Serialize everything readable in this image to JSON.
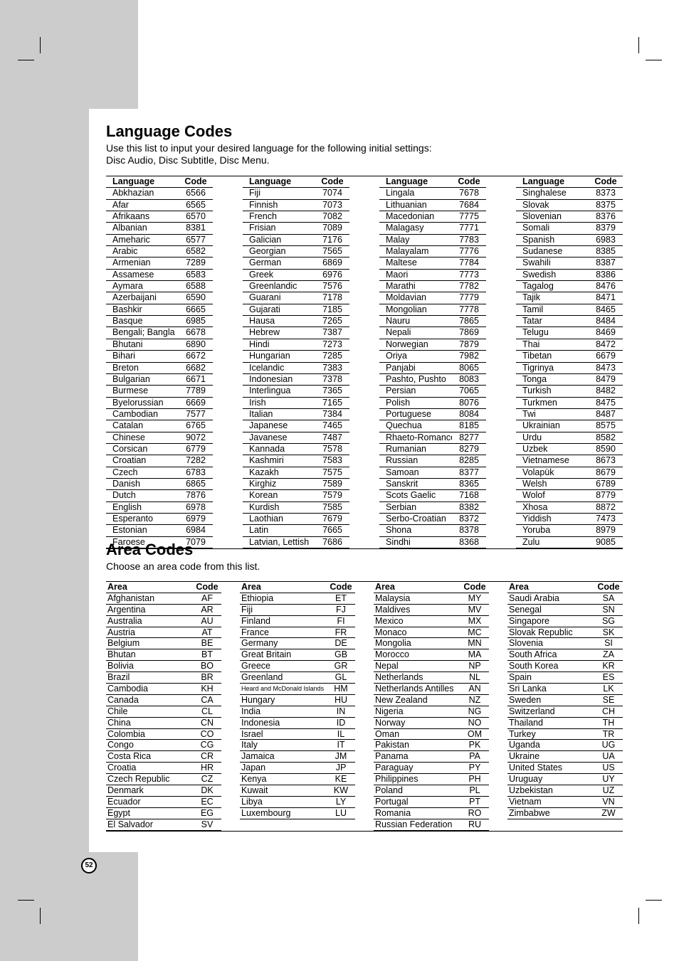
{
  "page_number": "52",
  "language_section": {
    "title": "Language Codes",
    "intro_line1": "Use this list to input your desired language for the following initial settings:",
    "intro_line2": "Disc Audio, Disc Subtitle, Disc Menu.",
    "header_name": "Language",
    "header_code": "Code",
    "columns": [
      [
        [
          "Abkhazian",
          "6566"
        ],
        [
          "Afar",
          "6565"
        ],
        [
          "Afrikaans",
          "6570"
        ],
        [
          "Albanian",
          "8381"
        ],
        [
          "Ameharic",
          "6577"
        ],
        [
          "Arabic",
          "6582"
        ],
        [
          "Armenian",
          "7289"
        ],
        [
          "Assamese",
          "6583"
        ],
        [
          "Aymara",
          "6588"
        ],
        [
          "Azerbaijani",
          "6590"
        ],
        [
          "Bashkir",
          "6665"
        ],
        [
          "Basque",
          "6985"
        ],
        [
          "Bengali; Bangla",
          "6678"
        ],
        [
          "Bhutani",
          "6890"
        ],
        [
          "Bihari",
          "6672"
        ],
        [
          "Breton",
          "6682"
        ],
        [
          "Bulgarian",
          "6671"
        ],
        [
          "Burmese",
          "7789"
        ],
        [
          "Byelorussian",
          "6669"
        ],
        [
          "Cambodian",
          "7577"
        ],
        [
          "Catalan",
          "6765"
        ],
        [
          "Chinese",
          "9072"
        ],
        [
          "Corsican",
          "6779"
        ],
        [
          "Croatian",
          "7282"
        ],
        [
          "Czech",
          "6783"
        ],
        [
          "Danish",
          "6865"
        ],
        [
          "Dutch",
          "7876"
        ],
        [
          "English",
          "6978"
        ],
        [
          "Esperanto",
          "6979"
        ],
        [
          "Estonian",
          "6984"
        ],
        [
          "Faroese",
          "7079"
        ]
      ],
      [
        [
          "Fiji",
          "7074"
        ],
        [
          "Finnish",
          "7073"
        ],
        [
          "French",
          "7082"
        ],
        [
          "Frisian",
          "7089"
        ],
        [
          "Galician",
          "7176"
        ],
        [
          "Georgian",
          "7565"
        ],
        [
          "German",
          "6869"
        ],
        [
          "Greek",
          "6976"
        ],
        [
          "Greenlandic",
          "7576"
        ],
        [
          "Guarani",
          "7178"
        ],
        [
          "Gujarati",
          "7185"
        ],
        [
          "Hausa",
          "7265"
        ],
        [
          "Hebrew",
          "7387"
        ],
        [
          "Hindi",
          "7273"
        ],
        [
          "Hungarian",
          "7285"
        ],
        [
          "Icelandic",
          "7383"
        ],
        [
          "Indonesian",
          "7378"
        ],
        [
          "Interlingua",
          "7365"
        ],
        [
          "Irish",
          "7165"
        ],
        [
          "Italian",
          "7384"
        ],
        [
          "Japanese",
          "7465"
        ],
        [
          "Javanese",
          "7487"
        ],
        [
          "Kannada",
          "7578"
        ],
        [
          "Kashmiri",
          "7583"
        ],
        [
          "Kazakh",
          "7575"
        ],
        [
          "Kirghiz",
          "7589"
        ],
        [
          "Korean",
          "7579"
        ],
        [
          "Kurdish",
          "7585"
        ],
        [
          "Laothian",
          "7679"
        ],
        [
          "Latin",
          "7665"
        ],
        [
          "Latvian, Lettish",
          "7686"
        ]
      ],
      [
        [
          "Lingala",
          "7678"
        ],
        [
          "Lithuanian",
          "7684"
        ],
        [
          "Macedonian",
          "7775"
        ],
        [
          "Malagasy",
          "7771"
        ],
        [
          "Malay",
          "7783"
        ],
        [
          "Malayalam",
          "7776"
        ],
        [
          "Maltese",
          "7784"
        ],
        [
          "Maori",
          "7773"
        ],
        [
          "Marathi",
          "7782"
        ],
        [
          "Moldavian",
          "7779"
        ],
        [
          "Mongolian",
          "7778"
        ],
        [
          "Nauru",
          "7865"
        ],
        [
          "Nepali",
          "7869"
        ],
        [
          "Norwegian",
          "7879"
        ],
        [
          "Oriya",
          "7982"
        ],
        [
          "Panjabi",
          "8065"
        ],
        [
          "Pashto, Pushto",
          "8083"
        ],
        [
          "Persian",
          "7065"
        ],
        [
          "Polish",
          "8076"
        ],
        [
          "Portuguese",
          "8084"
        ],
        [
          "Quechua",
          "8185"
        ],
        [
          "Rhaeto-Romance",
          "8277"
        ],
        [
          "Rumanian",
          "8279"
        ],
        [
          "Russian",
          "8285"
        ],
        [
          "Samoan",
          "8377"
        ],
        [
          "Sanskrit",
          "8365"
        ],
        [
          "Scots Gaelic",
          "7168"
        ],
        [
          "Serbian",
          "8382"
        ],
        [
          "Serbo-Croatian",
          "8372"
        ],
        [
          "Shona",
          "8378"
        ],
        [
          "Sindhi",
          "8368"
        ]
      ],
      [
        [
          "Singhalese",
          "8373"
        ],
        [
          "Slovak",
          "8375"
        ],
        [
          "Slovenian",
          "8376"
        ],
        [
          "Somali",
          "8379"
        ],
        [
          "Spanish",
          "6983"
        ],
        [
          "Sudanese",
          "8385"
        ],
        [
          "Swahili",
          "8387"
        ],
        [
          "Swedish",
          "8386"
        ],
        [
          "Tagalog",
          "8476"
        ],
        [
          "Tajik",
          "8471"
        ],
        [
          "Tamil",
          "8465"
        ],
        [
          "Tatar",
          "8484"
        ],
        [
          "Telugu",
          "8469"
        ],
        [
          "Thai",
          "8472"
        ],
        [
          "Tibetan",
          "6679"
        ],
        [
          "Tigrinya",
          "8473"
        ],
        [
          "Tonga",
          "8479"
        ],
        [
          "Turkish",
          "8482"
        ],
        [
          "Turkmen",
          "8475"
        ],
        [
          "Twi",
          "8487"
        ],
        [
          "Ukrainian",
          "8575"
        ],
        [
          "Urdu",
          "8582"
        ],
        [
          "Uzbek",
          "8590"
        ],
        [
          "Vietnamese",
          "8673"
        ],
        [
          "Volapük",
          "8679"
        ],
        [
          "Welsh",
          "6789"
        ],
        [
          "Wolof",
          "8779"
        ],
        [
          "Xhosa",
          "8872"
        ],
        [
          "Yiddish",
          "7473"
        ],
        [
          "Yoruba",
          "8979"
        ],
        [
          "Zulu",
          "9085"
        ]
      ]
    ]
  },
  "area_section": {
    "title": "Area Codes",
    "intro": "Choose an area code from this list.",
    "header_name": "Area",
    "header_code": "Code",
    "columns": [
      [
        [
          "Afghanistan",
          "AF"
        ],
        [
          "Argentina",
          "AR"
        ],
        [
          "Australia",
          "AU"
        ],
        [
          "Austria",
          "AT"
        ],
        [
          "Belgium",
          "BE"
        ],
        [
          "Bhutan",
          "BT"
        ],
        [
          "Bolivia",
          "BO"
        ],
        [
          "Brazil",
          "BR"
        ],
        [
          "Cambodia",
          "KH"
        ],
        [
          "Canada",
          "CA"
        ],
        [
          "Chile",
          "CL"
        ],
        [
          "China",
          "CN"
        ],
        [
          "Colombia",
          "CO"
        ],
        [
          "Congo",
          "CG"
        ],
        [
          "Costa Rica",
          "CR"
        ],
        [
          "Croatia",
          "HR"
        ],
        [
          "Czech Republic",
          "CZ"
        ],
        [
          "Denmark",
          "DK"
        ],
        [
          "Ecuador",
          "EC"
        ],
        [
          "Egypt",
          "EG"
        ],
        [
          "El Salvador",
          "SV"
        ]
      ],
      [
        [
          "Ethiopia",
          "ET"
        ],
        [
          "Fiji",
          "FJ"
        ],
        [
          "Finland",
          "FI"
        ],
        [
          "France",
          "FR"
        ],
        [
          "Germany",
          "DE"
        ],
        [
          "Great Britain",
          "GB"
        ],
        [
          "Greece",
          "GR"
        ],
        [
          "Greenland",
          "GL"
        ],
        [
          "Heard and McDonald Islands",
          "HM"
        ],
        [
          "Hungary",
          "HU"
        ],
        [
          "India",
          "IN"
        ],
        [
          "Indonesia",
          "ID"
        ],
        [
          "Israel",
          "IL"
        ],
        [
          "Italy",
          "IT"
        ],
        [
          "Jamaica",
          "JM"
        ],
        [
          "Japan",
          "JP"
        ],
        [
          "Kenya",
          "KE"
        ],
        [
          "Kuwait",
          "KW"
        ],
        [
          "Libya",
          "LY"
        ],
        [
          "Luxembourg",
          "LU"
        ]
      ],
      [
        [
          "Malaysia",
          "MY"
        ],
        [
          "Maldives",
          "MV"
        ],
        [
          "Mexico",
          "MX"
        ],
        [
          "Monaco",
          "MC"
        ],
        [
          "Mongolia",
          "MN"
        ],
        [
          "Morocco",
          "MA"
        ],
        [
          "Nepal",
          "NP"
        ],
        [
          "Netherlands",
          "NL"
        ],
        [
          "Netherlands Antilles",
          "AN"
        ],
        [
          "New Zealand",
          "NZ"
        ],
        [
          "Nigeria",
          "NG"
        ],
        [
          "Norway",
          "NO"
        ],
        [
          "Oman",
          "OM"
        ],
        [
          "Pakistan",
          "PK"
        ],
        [
          "Panama",
          "PA"
        ],
        [
          "Paraguay",
          "PY"
        ],
        [
          "Philippines",
          "PH"
        ],
        [
          "Poland",
          "PL"
        ],
        [
          "Portugal",
          "PT"
        ],
        [
          "Romania",
          "RO"
        ],
        [
          "Russian Federation",
          "RU"
        ]
      ],
      [
        [
          "Saudi Arabia",
          "SA"
        ],
        [
          "Senegal",
          "SN"
        ],
        [
          "Singapore",
          "SG"
        ],
        [
          "Slovak Republic",
          "SK"
        ],
        [
          "Slovenia",
          "SI"
        ],
        [
          "South Africa",
          "ZA"
        ],
        [
          "South Korea",
          "KR"
        ],
        [
          "Spain",
          "ES"
        ],
        [
          "Sri Lanka",
          "LK"
        ],
        [
          "Sweden",
          "SE"
        ],
        [
          "Switzerland",
          "CH"
        ],
        [
          "Thailand",
          "TH"
        ],
        [
          "Turkey",
          "TR"
        ],
        [
          "Uganda",
          "UG"
        ],
        [
          "Ukraine",
          "UA"
        ],
        [
          "United States",
          "US"
        ],
        [
          "Uruguay",
          "UY"
        ],
        [
          "Uzbekistan",
          "UZ"
        ],
        [
          "Vietnam",
          "VN"
        ],
        [
          "Zimbabwe",
          "ZW"
        ]
      ]
    ]
  }
}
